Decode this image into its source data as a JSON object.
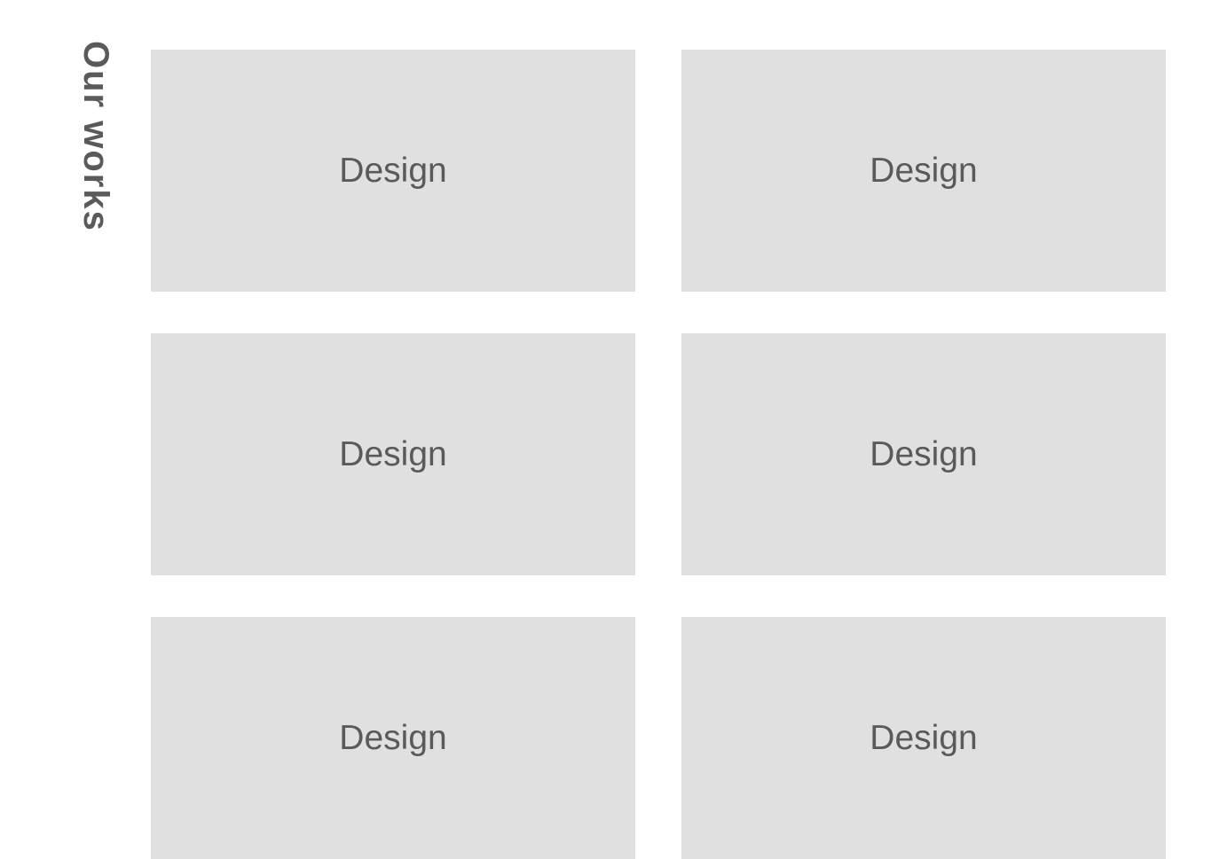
{
  "heading": "Our works",
  "cards": [
    {
      "label": "Design"
    },
    {
      "label": "Design"
    },
    {
      "label": "Design"
    },
    {
      "label": "Design"
    },
    {
      "label": "Design"
    },
    {
      "label": "Design"
    }
  ]
}
